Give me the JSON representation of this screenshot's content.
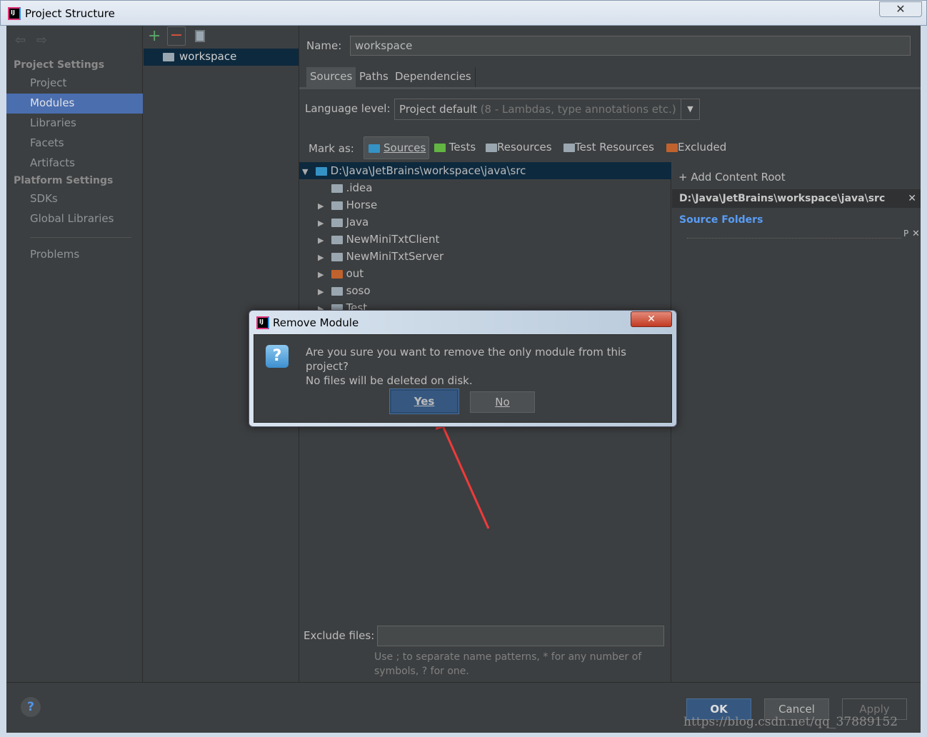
{
  "window": {
    "title": "Project Structure"
  },
  "sidebar": {
    "project_settings_header": "Project Settings",
    "items": [
      {
        "label": "Project"
      },
      {
        "label": "Modules"
      },
      {
        "label": "Libraries"
      },
      {
        "label": "Facets"
      },
      {
        "label": "Artifacts"
      }
    ],
    "platform_settings_header": "Platform Settings",
    "platform_items": [
      {
        "label": "SDKs"
      },
      {
        "label": "Global Libraries"
      }
    ],
    "problems": "Problems",
    "selected": "Modules"
  },
  "modules": {
    "items": [
      {
        "label": "workspace"
      }
    ]
  },
  "content": {
    "name_label": "Name:",
    "name_value": "workspace",
    "tabs": [
      {
        "label": "Sources"
      },
      {
        "label": "Paths"
      },
      {
        "label": "Dependencies"
      }
    ],
    "language_level_label": "Language level:",
    "language_level_value": "Project default",
    "language_level_hint": "(8 - Lambdas, type annotations etc.)",
    "mark_as_label": "Mark as:",
    "mark_as": [
      {
        "label": "Sources",
        "color": "#3592c4"
      },
      {
        "label": "Tests",
        "color": "#62b543"
      },
      {
        "label": "Resources",
        "color": "#9aa7b0"
      },
      {
        "label": "Test Resources",
        "color": "#9aa7b0"
      },
      {
        "label": "Excluded",
        "color": "#c0622d"
      }
    ],
    "tree": {
      "root": "D:\\Java\\JetBrains\\workspace\\java\\src",
      "children": [
        {
          "label": ".idea",
          "expandable": false,
          "color": "#9aa7b0"
        },
        {
          "label": "Horse",
          "expandable": true,
          "color": "#9aa7b0"
        },
        {
          "label": "Java",
          "expandable": true,
          "color": "#9aa7b0"
        },
        {
          "label": "NewMiniTxtClient",
          "expandable": true,
          "color": "#9aa7b0"
        },
        {
          "label": "NewMiniTxtServer",
          "expandable": true,
          "color": "#9aa7b0"
        },
        {
          "label": "out",
          "expandable": true,
          "color": "#c0622d"
        },
        {
          "label": "soso",
          "expandable": true,
          "color": "#9aa7b0"
        },
        {
          "label": "Test",
          "expandable": true,
          "color": "#9aa7b0"
        }
      ]
    },
    "add_content_root": "Add Content Root",
    "content_root": "D:\\Java\\JetBrains\\workspace\\java\\src",
    "source_folders": "Source Folders",
    "exclude_files_label": "Exclude files:",
    "exclude_files_value": "",
    "exclude_hint": "Use ; to separate name patterns, * for any number of symbols, ? for one."
  },
  "footer": {
    "ok": "OK",
    "cancel": "Cancel",
    "apply": "Apply"
  },
  "dialog": {
    "title": "Remove Module",
    "message_line1": "Are you sure you want to remove the only module from this project?",
    "message_line2": "No files will be deleted on disk.",
    "yes": "Yes",
    "no": "No"
  },
  "watermark": "https://blog.csdn.net/qq_37889152"
}
